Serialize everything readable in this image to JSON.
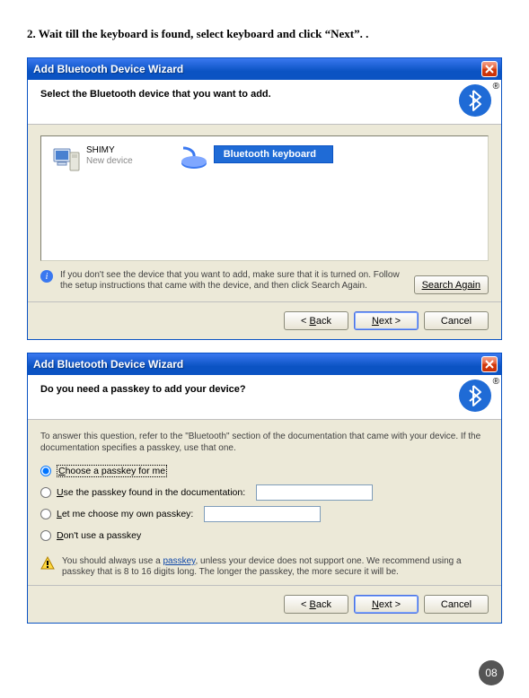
{
  "instruction": "2. Wait till the keyboard is found, select keyboard and click “Next”. .",
  "dialog1": {
    "title": "Add Bluetooth Device Wizard",
    "header": "Select the Bluetooth device that you want to add.",
    "devices": [
      {
        "name": "SHIMY",
        "sub": "New device"
      }
    ],
    "highlight_label": "Bluetooth keyboard",
    "info": "If you don't see the device that you want to add, make sure that it is turned on. Follow the setup instructions that came with the device, and then click Search Again.",
    "search_btn": "Search Again",
    "back_btn": {
      "pre": "< ",
      "u": "B",
      "post": "ack"
    },
    "next_btn": {
      "u": "N",
      "post": "ext >"
    },
    "cancel_btn": "Cancel"
  },
  "dialog2": {
    "title": "Add Bluetooth Device Wizard",
    "header": "Do you need a passkey to add your device?",
    "explain": "To answer this question, refer to the \"Bluetooth\" section of the documentation that came with your device. If the documentation specifies a passkey, use that one.",
    "opts": {
      "choose": {
        "u": "C",
        "post": "hoose a passkey for me"
      },
      "usedoc": {
        "u": "U",
        "post": "se the passkey found in the documentation:"
      },
      "own": {
        "u": "L",
        "post": "et me choose my own passkey:"
      },
      "none": {
        "u": "D",
        "post": "on't use a passkey"
      }
    },
    "warn_pre": "You should always use a ",
    "warn_link": "passkey",
    "warn_post": ", unless your device does not support one. We recommend using a passkey that is 8 to 16 digits long. The longer the passkey, the more secure it will be.",
    "back_btn": {
      "pre": "< ",
      "u": "B",
      "post": "ack"
    },
    "next_btn": {
      "u": "N",
      "post": "ext >"
    },
    "cancel_btn": "Cancel"
  },
  "page_number": "08"
}
